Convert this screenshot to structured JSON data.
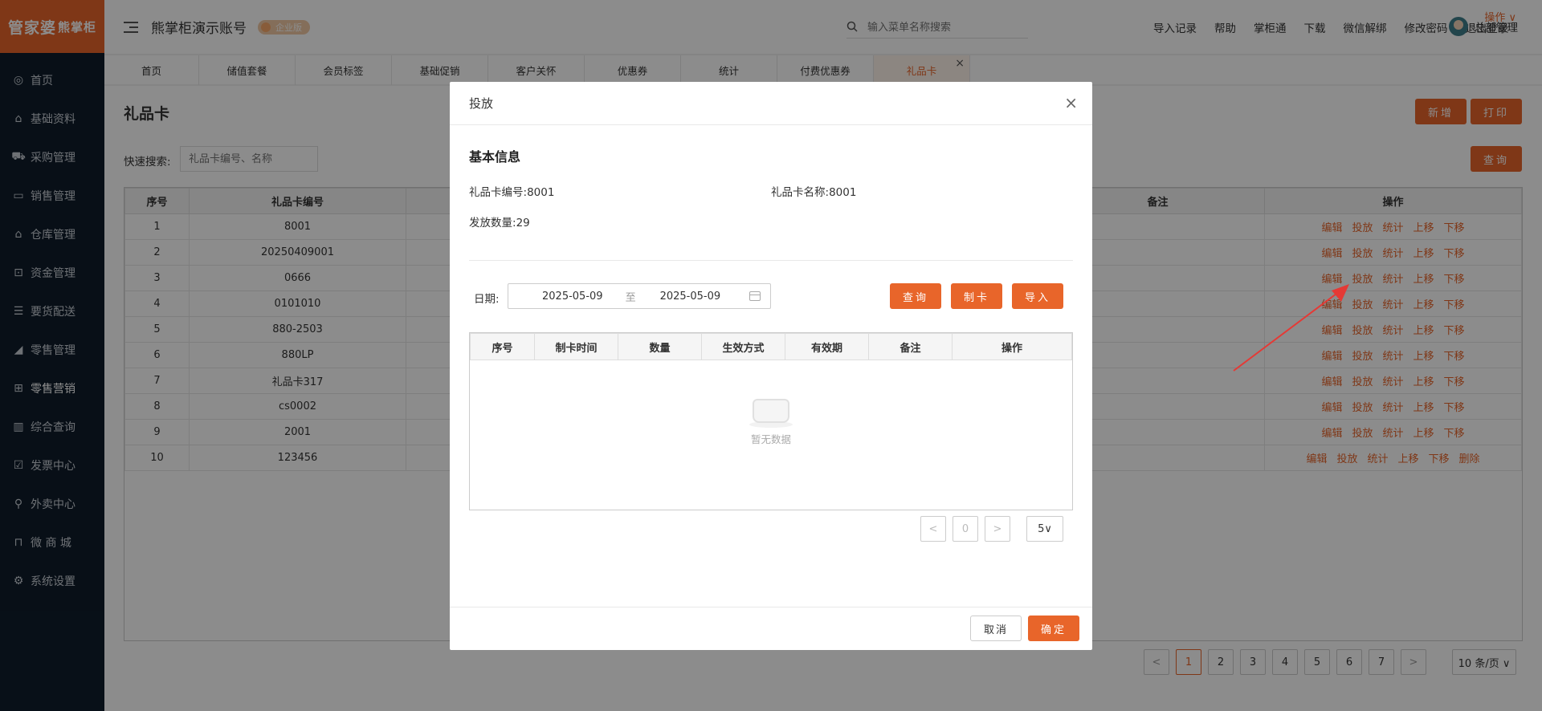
{
  "logo": {
    "main": "管家婆",
    "sub": "熊掌柜"
  },
  "sidebar": {
    "items": [
      {
        "label": "首页",
        "icon": "globe-icon"
      },
      {
        "label": "基础资料",
        "icon": "home-icon"
      },
      {
        "label": "采购管理",
        "icon": "cart-icon"
      },
      {
        "label": "销售管理",
        "icon": "sales-icon"
      },
      {
        "label": "仓库管理",
        "icon": "warehouse-icon"
      },
      {
        "label": "资金管理",
        "icon": "money-icon"
      },
      {
        "label": "要货配送",
        "icon": "delivery-icon"
      },
      {
        "label": "零售管理",
        "icon": "retail-icon"
      },
      {
        "label": "零售营销",
        "icon": "gift-icon"
      },
      {
        "label": "综合查询",
        "icon": "chart-icon"
      },
      {
        "label": "发票中心",
        "icon": "invoice-icon"
      },
      {
        "label": "外卖中心",
        "icon": "takeout-icon"
      },
      {
        "label": "微 商 城",
        "icon": "shop-icon"
      },
      {
        "label": "系统设置",
        "icon": "gear-icon"
      }
    ],
    "active_index": 8
  },
  "header": {
    "title": "熊掌柜演示账号",
    "badge": "企业版",
    "search_placeholder": "输入菜单名称搜索",
    "links": [
      "导入记录",
      "帮助",
      "掌柜通",
      "下载",
      "微信解绑",
      "修改密码",
      "退出登录"
    ],
    "user": "总部管理"
  },
  "tabs": {
    "items": [
      "首页",
      "储值套餐",
      "会员标签",
      "基础促销",
      "客户关怀",
      "优惠券",
      "统计",
      "付费优惠券",
      "礼品卡"
    ],
    "active_index": 8,
    "close": "×",
    "operation": "操作 ∨"
  },
  "main": {
    "title": "礼品卡",
    "btn_new": "新增",
    "btn_print": "打印",
    "btn_query": "查询",
    "quick_label": "快速搜索:",
    "quick_placeholder": "礼品卡编号、名称",
    "columns": [
      "序号",
      "礼品卡编号",
      "",
      "备注",
      "操作"
    ],
    "rows": [
      {
        "no": "1",
        "code": "8001"
      },
      {
        "no": "2",
        "code": "20250409001"
      },
      {
        "no": "3",
        "code": "0666"
      },
      {
        "no": "4",
        "code": "0101010"
      },
      {
        "no": "5",
        "code": "880-2503"
      },
      {
        "no": "6",
        "code": "880LP"
      },
      {
        "no": "7",
        "code": "礼品卡317"
      },
      {
        "no": "8",
        "code": "cs0002"
      },
      {
        "no": "9",
        "code": "2001"
      },
      {
        "no": "10",
        "code": "123456"
      }
    ],
    "ops": [
      "编辑",
      "投放",
      "统计",
      "上移",
      "下移"
    ],
    "ops_last": [
      "编辑",
      "投放",
      "统计",
      "上移",
      "下移",
      "删除"
    ]
  },
  "pager": {
    "prev": "<",
    "pages": [
      "1",
      "2",
      "3",
      "4",
      "5",
      "6",
      "7"
    ],
    "current": "1",
    "next": ">",
    "size": "10 条/页 ∨"
  },
  "modal": {
    "title": "投放",
    "close": "×",
    "section": "基本信息",
    "code_label": "礼品卡编号:",
    "code_value": "8001",
    "name_label": "礼品卡名称:",
    "name_value": "8001",
    "qty_label": "发放数量:",
    "qty_value": "29",
    "date_label": "日期:",
    "date_from": "2025-05-09",
    "date_sep": "至",
    "date_to": "2025-05-09",
    "btn_query": "查询",
    "btn_make": "制卡",
    "btn_import": "导入",
    "columns": [
      "序号",
      "制卡时间",
      "数量",
      "生效方式",
      "有效期",
      "备注",
      "操作"
    ],
    "empty_text": "暂无数据",
    "pager": {
      "prev": "<",
      "page": "0",
      "next": ">",
      "size": "5∨"
    },
    "btn_cancel": "取消",
    "btn_ok": "确定"
  },
  "colors": {
    "accent": "#e8652a",
    "sidebar_bg": "#0f1d2b"
  }
}
